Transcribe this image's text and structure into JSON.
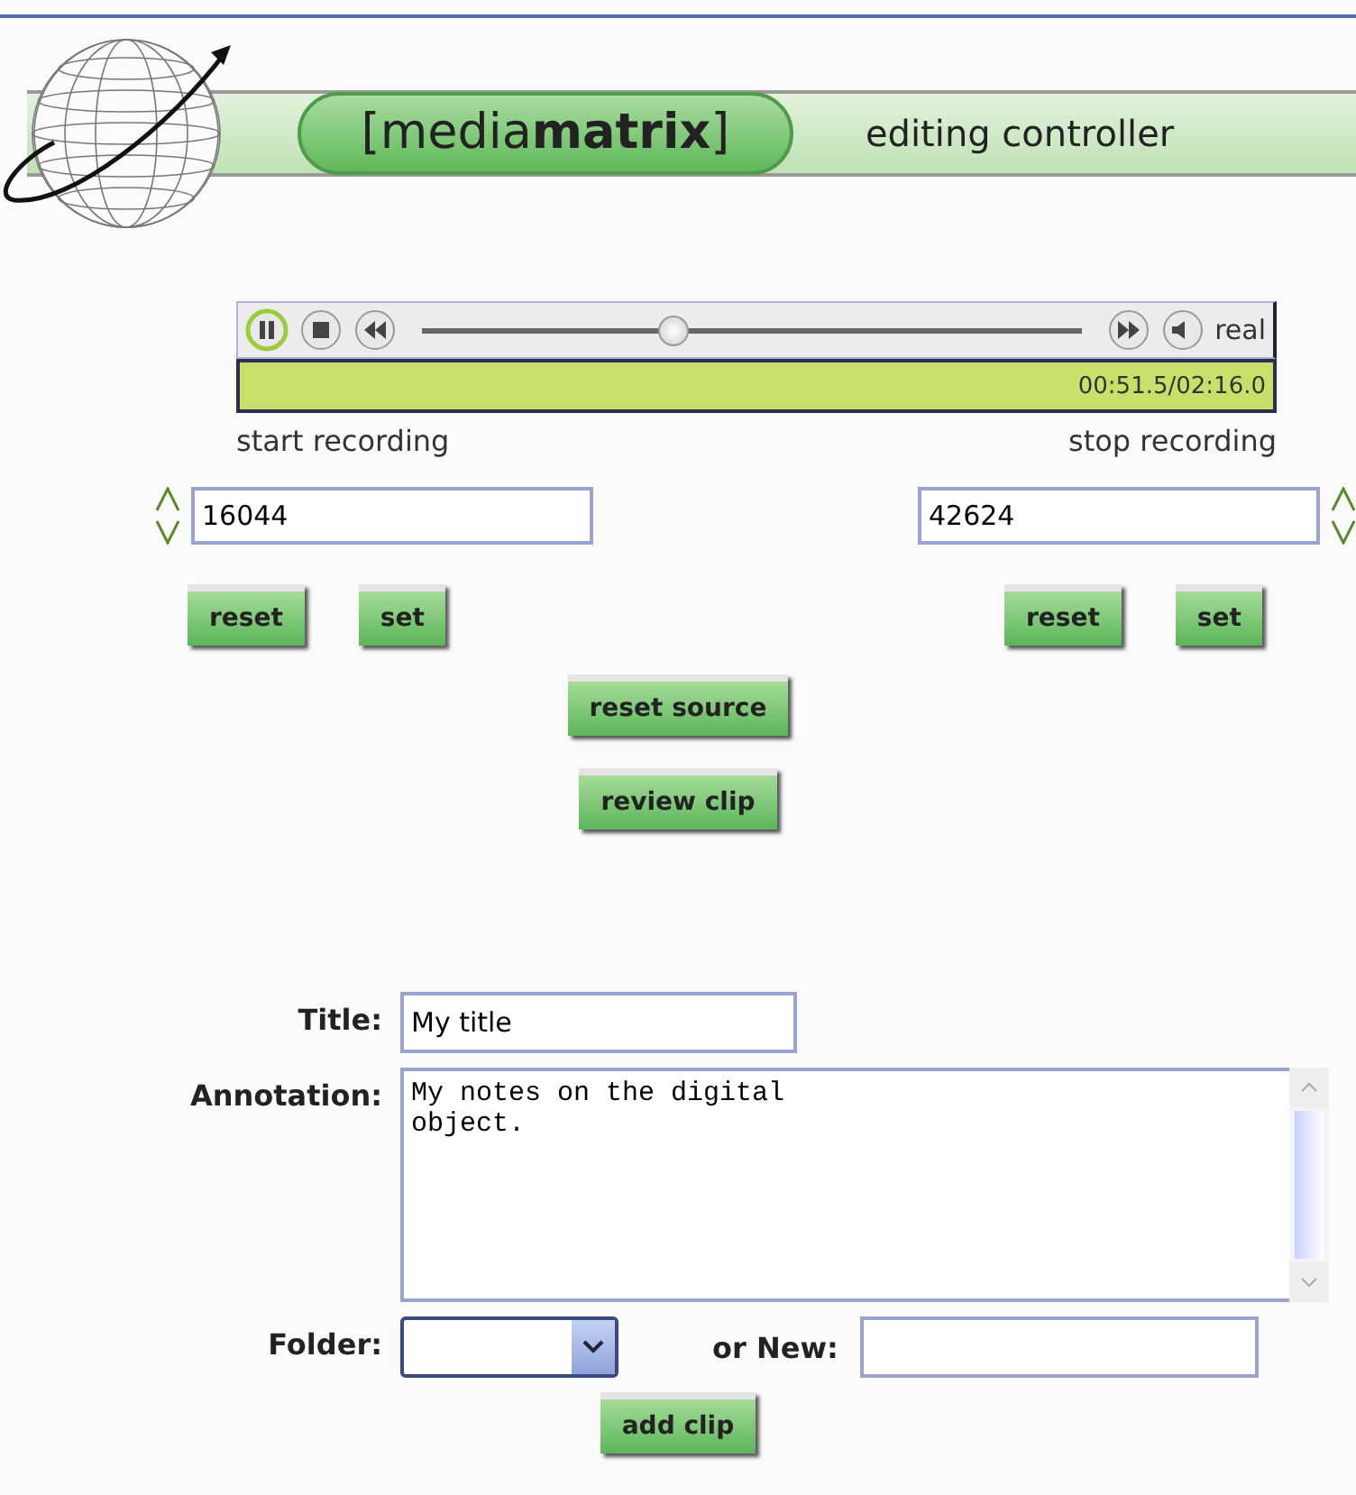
{
  "header": {
    "brand": "[media**matrix**]",
    "subtitle": "editing controller"
  },
  "player": {
    "playing": true,
    "level": 0.38,
    "label": "real",
    "time": "00:51.5/02:16.0"
  },
  "recording": {
    "start_label": "start recording",
    "stop_label": "stop recording",
    "start": {
      "value": "16044",
      "buttons": [
        "reset",
        "set"
      ]
    },
    "stop": {
      "value": "42624",
      "buttons": [
        "reset",
        "set"
      ]
    }
  },
  "center_buttons": [
    "reset source",
    "review clip"
  ],
  "form": {
    "title_label": "Title:",
    "title_value": "My title",
    "annotation_label": "Annotation:",
    "annotation_value": "My notes on the digital\nobject.",
    "folder_label": "Folder:",
    "new_label": "or New:",
    "submit": "add clip"
  }
}
